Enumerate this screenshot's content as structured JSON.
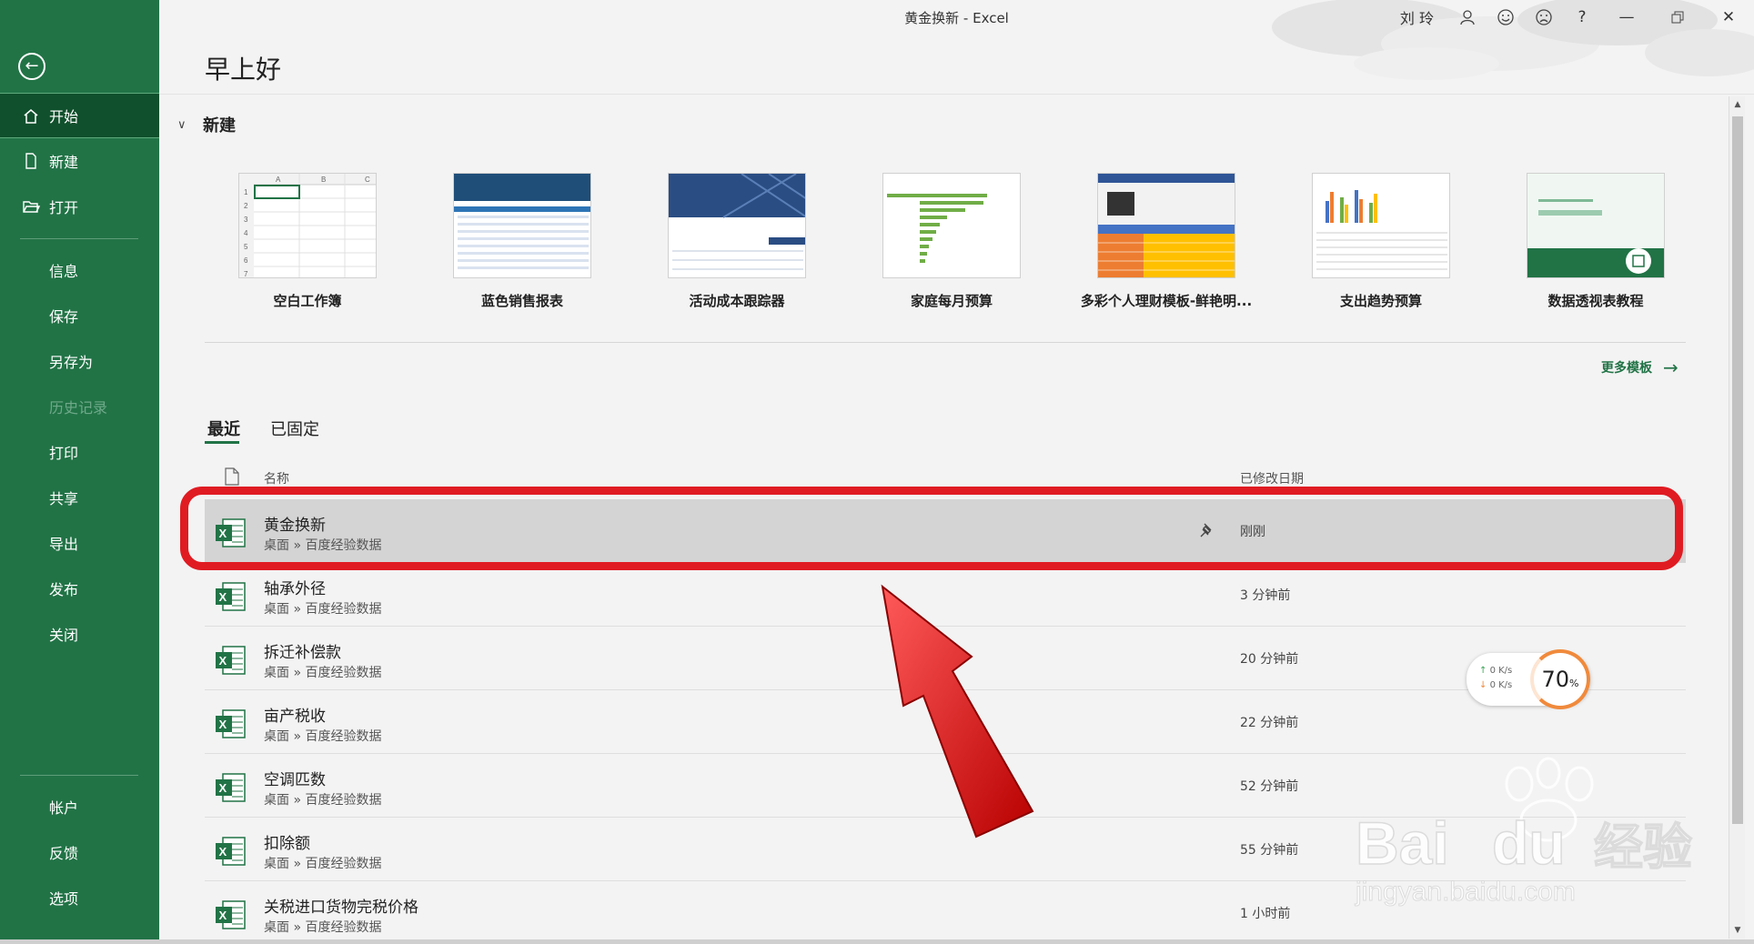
{
  "window": {
    "title": "黄金换新  -  Excel",
    "user": "刘 玲"
  },
  "sidebar": {
    "items": [
      {
        "label": "开始",
        "icon": "home-icon"
      },
      {
        "label": "新建",
        "icon": "new-document-icon"
      },
      {
        "label": "打开",
        "icon": "folder-open-icon"
      },
      {
        "label": "信息"
      },
      {
        "label": "保存"
      },
      {
        "label": "另存为"
      },
      {
        "label": "历史记录"
      },
      {
        "label": "打印"
      },
      {
        "label": "共享"
      },
      {
        "label": "导出"
      },
      {
        "label": "发布"
      },
      {
        "label": "关闭"
      },
      {
        "label": "帐户"
      },
      {
        "label": "反馈"
      },
      {
        "label": "选项"
      }
    ]
  },
  "greeting": "早上好",
  "new_section": {
    "title": "新建",
    "templates": [
      {
        "label": "空白工作簿"
      },
      {
        "label": "蓝色销售报表"
      },
      {
        "label": "活动成本跟踪器"
      },
      {
        "label": "家庭每月预算"
      },
      {
        "label": "多彩个人理财模板-鲜艳明..."
      },
      {
        "label": "支出趋势预算"
      },
      {
        "label": "数据透视表教程"
      }
    ],
    "more_templates": "更多模板"
  },
  "tabs": {
    "recent": "最近",
    "pinned": "已固定"
  },
  "list_header": {
    "name": "名称",
    "modified": "已修改日期"
  },
  "files": [
    {
      "name": "黄金换新",
      "path": "桌面 » 百度经验数据",
      "date": "刚刚"
    },
    {
      "name": "轴承外径",
      "path": "桌面 » 百度经验数据",
      "date": "3 分钟前"
    },
    {
      "name": "拆迁补偿款",
      "path": "桌面 » 百度经验数据",
      "date": "20 分钟前"
    },
    {
      "name": "亩产税收",
      "path": "桌面 » 百度经验数据",
      "date": "22 分钟前"
    },
    {
      "name": "空调匹数",
      "path": "桌面 » 百度经验数据",
      "date": "52 分钟前"
    },
    {
      "name": "扣除额",
      "path": "桌面 » 百度经验数据",
      "date": "55 分钟前"
    },
    {
      "name": "关税进口货物完税价格",
      "path": "桌面 » 百度经验数据",
      "date": "1 小时前"
    }
  ],
  "speed_widget": {
    "up": "0  K/s",
    "down": "0  K/s",
    "percent": "70",
    "unit": "%"
  },
  "colors": {
    "excel_green": "#217346",
    "highlight_red": "#e01b22"
  }
}
